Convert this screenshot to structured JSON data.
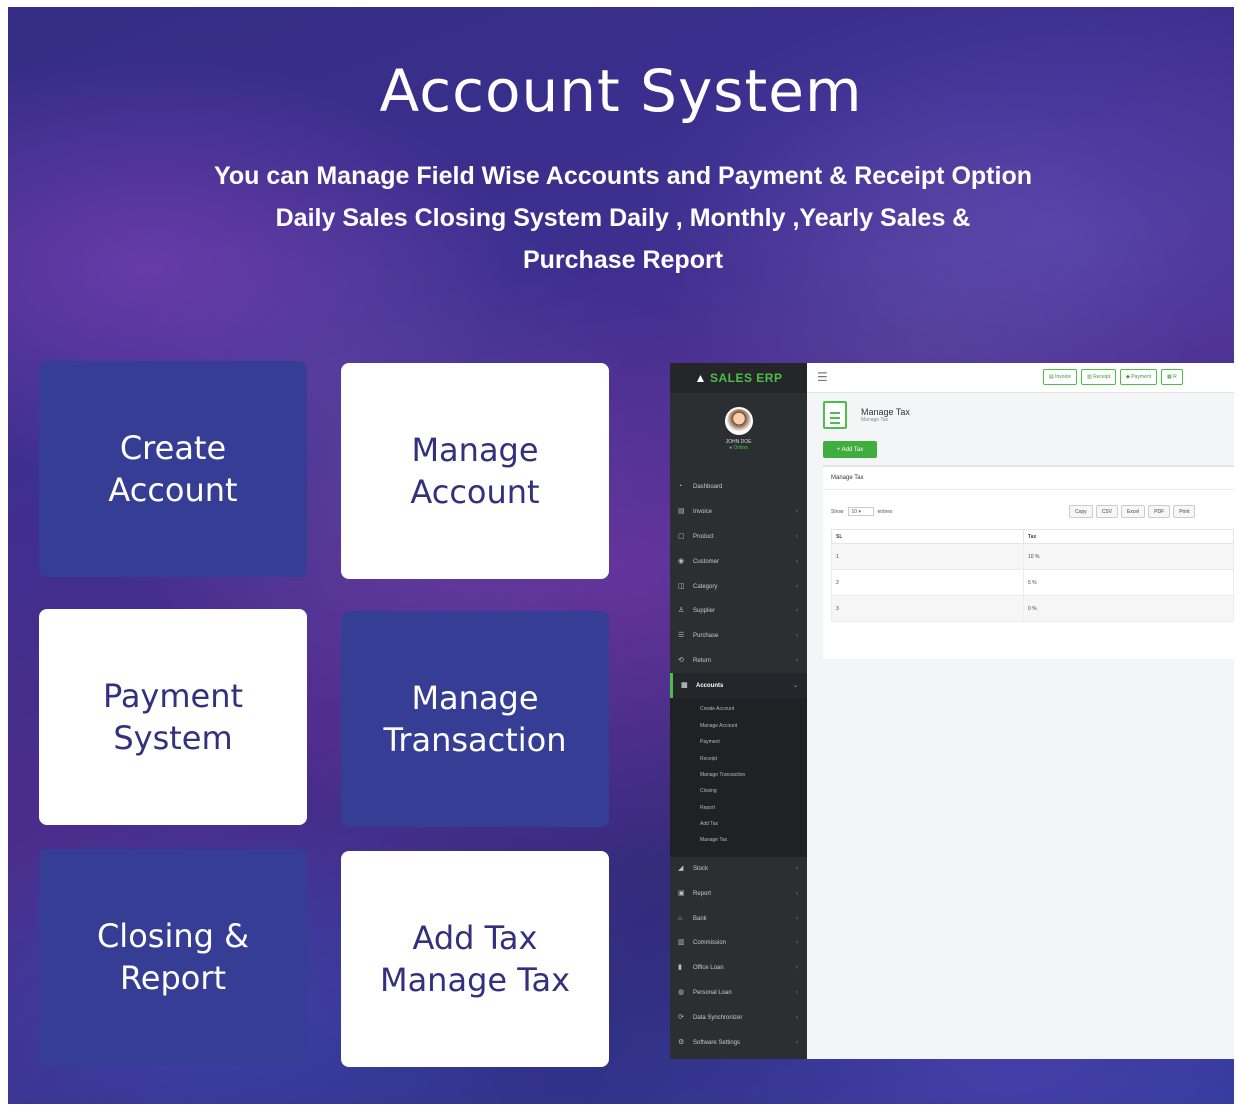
{
  "header": {
    "title": "Account System",
    "subtitle_lines": [
      "You can Manage Field Wise Accounts and Payment & Receipt Option",
      "Daily Sales Closing System Daily , Monthly ,Yearly Sales &",
      "Purchase Report"
    ]
  },
  "cards": [
    {
      "label": "Create\nAccount"
    },
    {
      "label": "Manage\nAccount"
    },
    {
      "label": "Payment\nSystem"
    },
    {
      "label": "Manage\nTransaction"
    },
    {
      "label": "Closing &\nReport"
    },
    {
      "label": "Add Tax\nManage Tax"
    }
  ],
  "colors": {
    "card_dark": "#353d95",
    "card_light": "#ffffff",
    "card_light_text": "#33307e",
    "brand_green": "#4cbe4a"
  },
  "app": {
    "logo": "SALES ERP",
    "user": {
      "name": "JOHN DOE",
      "status": "Online"
    },
    "top_buttons": [
      "Invoice",
      "Receipt",
      "Payment",
      "R"
    ],
    "menu": [
      {
        "label": "Dashboard",
        "icon": "dashboard-icon",
        "has_chevron": false
      },
      {
        "label": "Invoice",
        "icon": "invoice-icon",
        "has_chevron": true
      },
      {
        "label": "Product",
        "icon": "product-icon",
        "has_chevron": true
      },
      {
        "label": "Customer",
        "icon": "customer-icon",
        "has_chevron": true
      },
      {
        "label": "Category",
        "icon": "category-icon",
        "has_chevron": true
      },
      {
        "label": "Supplier",
        "icon": "supplier-icon",
        "has_chevron": true
      },
      {
        "label": "Purchase",
        "icon": "purchase-icon",
        "has_chevron": true
      },
      {
        "label": "Return",
        "icon": "return-icon",
        "has_chevron": true
      },
      {
        "label": "Accounts",
        "icon": "accounts-icon",
        "has_chevron": true,
        "active": true
      }
    ],
    "accounts_submenu": [
      "Create Account",
      "Manage Account",
      "Payment",
      "Receipt",
      "Manage Transaction",
      "Closing",
      "Report",
      "Add Tax",
      "Manage Tax"
    ],
    "menu_after": [
      {
        "label": "Stock",
        "icon": "stock-icon"
      },
      {
        "label": "Report",
        "icon": "report-icon"
      },
      {
        "label": "Bank",
        "icon": "bank-icon"
      },
      {
        "label": "Commission",
        "icon": "commission-icon"
      },
      {
        "label": "Office Loan",
        "icon": "office-loan-icon"
      },
      {
        "label": "Personal Loan",
        "icon": "personal-loan-icon"
      },
      {
        "label": "Data Synchronizer",
        "icon": "sync-icon"
      },
      {
        "label": "Software Settings",
        "icon": "settings-icon"
      }
    ],
    "page": {
      "title": "Manage Tax",
      "breadcrumb": "Manage Tax"
    },
    "add_button": "+ Add Tax",
    "panel_title": "Manage Tax",
    "show_label": "Show",
    "show_value": "10",
    "entries_label": "entries",
    "export_buttons": [
      "Copy",
      "CSV",
      "Excel",
      "PDF",
      "Print"
    ],
    "table": {
      "columns": [
        "SL",
        "Tax"
      ],
      "rows": [
        [
          "1",
          "10 %"
        ],
        [
          "2",
          "5 %"
        ],
        [
          "3",
          "0 %"
        ]
      ]
    }
  }
}
